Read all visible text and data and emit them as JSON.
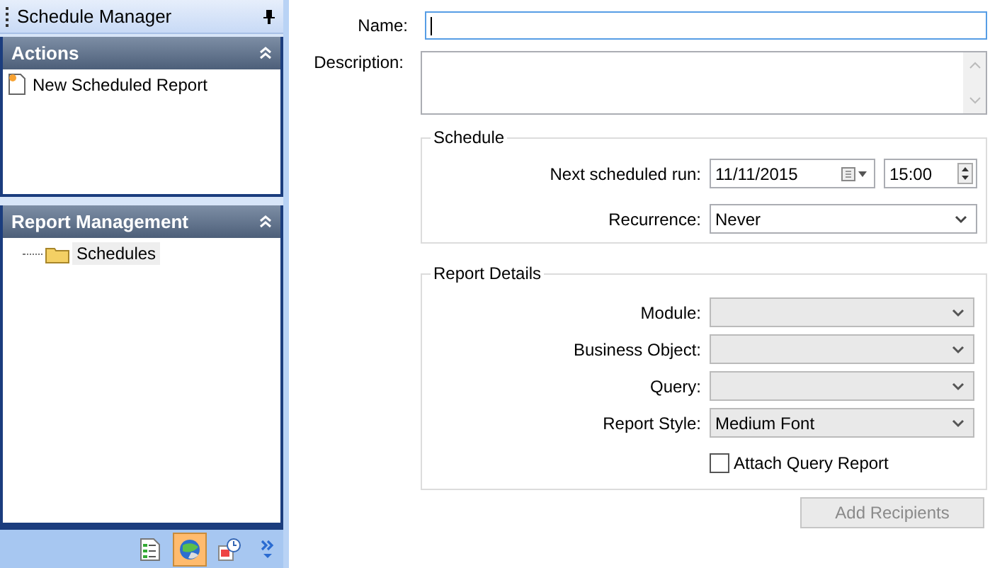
{
  "sidebar": {
    "title": "Schedule Manager",
    "sections": [
      {
        "title": "Actions",
        "kind": "actions",
        "items": [
          {
            "label": "New Scheduled Report",
            "selected": false
          }
        ]
      },
      {
        "title": "Report Management",
        "kind": "tree",
        "items": [
          {
            "label": "Schedules",
            "selected": true
          }
        ]
      }
    ],
    "nav_buttons": [
      {
        "kind": "list",
        "selected": false
      },
      {
        "kind": "globe",
        "selected": true
      },
      {
        "kind": "calendar",
        "selected": false
      }
    ]
  },
  "form": {
    "name": {
      "label": "Name:"
    },
    "description": {
      "label": "Description:"
    },
    "schedule": {
      "title": "Schedule",
      "next_run_label": "Next scheduled run:",
      "date": "11/11/2015",
      "time": "15:00",
      "recurrence_label": "Recurrence:",
      "recurrence": "Never"
    },
    "report_details": {
      "title": "Report Details",
      "fields": [
        {
          "label": "Module:"
        },
        {
          "label": "Business Object:"
        },
        {
          "label": "Query:"
        },
        {
          "label": "Report Style:",
          "value": "Medium Font"
        }
      ],
      "attach_query_report": {
        "label": "Attach Query Report",
        "checked": false
      }
    },
    "add_recipients": {
      "label": "Add Recipients",
      "disabled": true
    }
  }
}
